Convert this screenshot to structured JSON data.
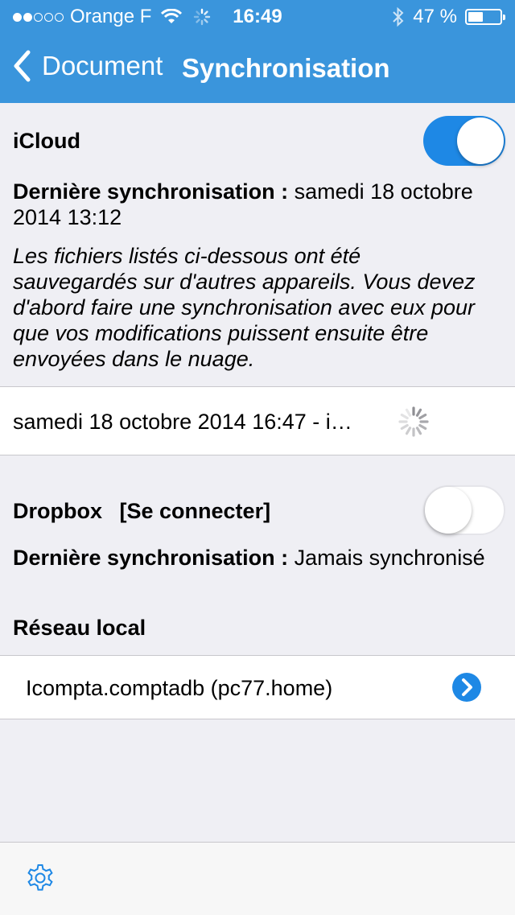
{
  "status_bar": {
    "carrier": "Orange F",
    "time": "16:49",
    "battery_text": "47 %",
    "battery_level": 0.47,
    "signal_bars_filled": 2,
    "signal_bars_total": 5
  },
  "nav": {
    "back_label": "Document",
    "title": "Synchronisation"
  },
  "icloud": {
    "label": "iCloud",
    "enabled": true,
    "last_sync_label": "Dernière synchronisation :",
    "last_sync_value_line1": "samedi 18 octobre",
    "last_sync_value_line2": "2014 13:12",
    "notice_lines": [
      "Les fichiers listés ci-dessous ont été",
      "sauvegardés sur d'autres appareils. Vous devez",
      "d'abord faire une synchronisation avec eux pour",
      "que vos modifications puissent ensuite être",
      "envoyées dans le nuage."
    ],
    "pending_item": "samedi 18 octobre 2014 16:47 - i…"
  },
  "dropbox": {
    "label": "Dropbox",
    "connect_label": "[Se connecter]",
    "enabled": false,
    "last_sync_label": "Dernière synchronisation :",
    "last_sync_value": "Jamais synchronisé"
  },
  "local_network": {
    "label": "Réseau local",
    "items": [
      "Icompta.comptadb (pc77.home)"
    ]
  },
  "colors": {
    "accent": "#1e88e5",
    "bar": "#3a95dc",
    "background": "#efeff4"
  },
  "icons": [
    "wifi-icon",
    "activity-spinner-icon",
    "bluetooth-icon",
    "battery-icon",
    "back-chevron-icon",
    "loading-spinner-icon",
    "chevron-right-icon",
    "gear-icon"
  ]
}
